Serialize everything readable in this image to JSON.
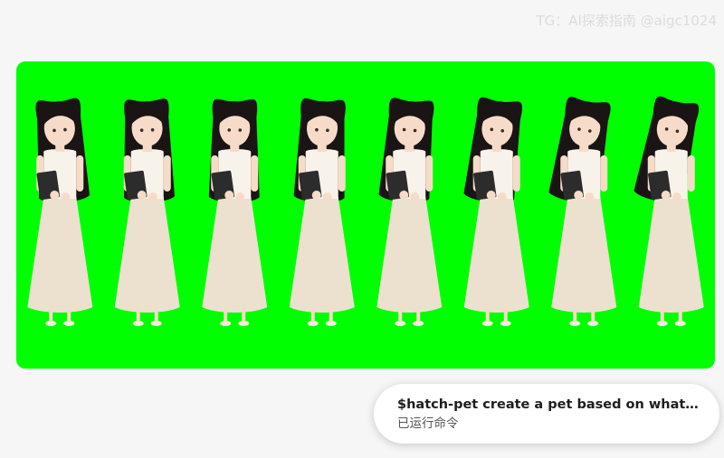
{
  "watermark": {
    "text": "TG：AI探索指南 @aigc1024"
  },
  "sprite_sheet": {
    "background_color": "#00ff00",
    "frame_count": 8,
    "character": {
      "hair_color": "#1a1414",
      "skin_color": "#f6dcc8",
      "dress_color": "#ece0cf",
      "vest_color": "#f8f3ea",
      "folder_color": "#2c2c2c",
      "shoe_color": "#f5ecdc"
    }
  },
  "command": {
    "title": "$hatch-pet create a pet based on what you...",
    "status": "已运行命令"
  }
}
